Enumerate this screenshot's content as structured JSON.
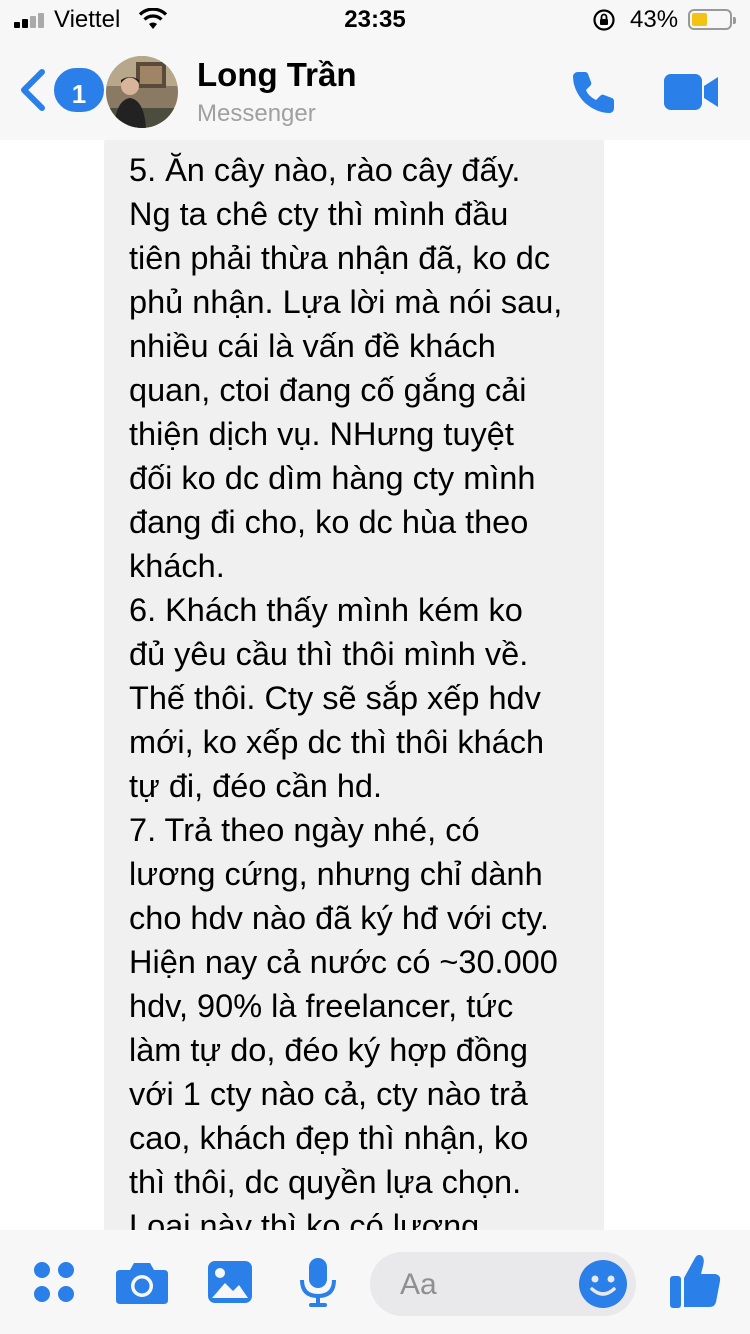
{
  "status_bar": {
    "carrier": "Viettel",
    "time": "23:35",
    "battery": "43%",
    "battery_level": 0.43
  },
  "header": {
    "back_badge": "1",
    "name": "Long Trần",
    "subtitle": "Messenger"
  },
  "message": {
    "lines": [
      "5. Ăn cây nào, rào cây đấy.",
      "Ng ta chê cty thì mình đầu",
      "tiên phải thừa nhận đã, ko dc",
      "phủ nhận. Lựa lời mà nói sau,",
      "nhiều cái là vấn đề khách",
      "quan, ctoi đang cố gắng cải",
      "thiện dịch vụ. NHưng tuyệt",
      "đối ko dc dìm hàng cty mình",
      "đang đi cho, ko dc hùa theo",
      "khách.",
      "6. Khách thấy mình kém ko",
      "đủ yêu cầu thì thôi mình về.",
      "Thế thôi. Cty sẽ sắp xếp hdv",
      "mới, ko xếp dc thì thôi khách",
      "tự đi, đéo cần hd.",
      "7. Trả theo ngày nhé, có",
      "lương cứng, nhưng chỉ dành",
      "cho hdv nào đã ký hđ với cty.",
      "Hiện nay cả nước có ~30.000",
      "hdv, 90% là freelancer, tức",
      "làm tự do, đéo ký hợp đồng",
      "với 1 cty nào cả, cty nào trả",
      "cao, khách đẹp thì nhận, ko",
      "thì thôi, dc quyền lựa chọn.",
      "Loại này thì ko có lương"
    ]
  },
  "composer": {
    "placeholder": "Aa"
  },
  "icons": {
    "back": "chevron-left-icon",
    "call": "phone-icon",
    "video": "video-camera-icon",
    "more": "grid-dots-icon",
    "camera": "camera-icon",
    "gallery": "image-icon",
    "mic": "microphone-icon",
    "emoji": "smiley-icon",
    "like": "thumbs-up-icon"
  },
  "colors": {
    "accent": "#2a7fe8",
    "bubble": "#f0f0f0",
    "battery": "#f2c315"
  }
}
